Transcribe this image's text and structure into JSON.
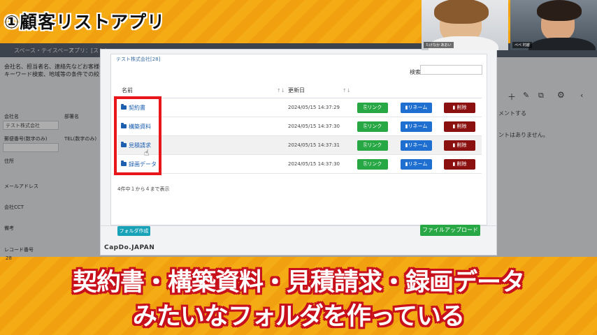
{
  "overlay": {
    "title": "①顧客リストアプリ",
    "caption_line1": "契約書・構築資料・見積請求・録画データ",
    "caption_line2": "みたいなフォルダを作っている"
  },
  "webcams": [
    {
      "label": "たけなか あおい"
    },
    {
      "label": "ぺぺ 村越"
    }
  ],
  "background_app": {
    "nav": [
      "スペース・テイスペース",
      "アプリ：[ストレ"
    ],
    "description_1": "会社名、担当者名、連絡先などお客様の情",
    "description_2": "キーワード検索、地域等の条件での絞り込",
    "fields": [
      {
        "label": "会社名",
        "value": "テスト株式会社"
      },
      {
        "label": "郵便番号(数字のみ)",
        "value": ""
      },
      {
        "label": "住所",
        "value": ""
      },
      {
        "label": "メールアドレス",
        "value": ""
      },
      {
        "label": "会社CCT",
        "value": ""
      },
      {
        "label": "備考",
        "value": ""
      },
      {
        "label": "レコード番号",
        "value": "28"
      }
    ],
    "field_department": "部署名",
    "field_tel": "TEL(数字のみ)",
    "right_comment": "メントする",
    "right_nocomment": "ントはありません。"
  },
  "modal": {
    "company": "テスト株式会社[28]",
    "search_label": "検索",
    "search_value": "",
    "col_name": "名前",
    "col_updated": "更新日",
    "rows": [
      {
        "name": "契約書",
        "updated": "2024/05/15 14:37:29",
        "link": "リンク",
        "rename": "リネーム",
        "delete": "削除"
      },
      {
        "name": "構築資料",
        "updated": "2024/05/15 14:37:30",
        "link": "リンク",
        "rename": "リネーム",
        "delete": "削除"
      },
      {
        "name": "見積請求",
        "updated": "2024/05/15 14:37:31",
        "link": "リンク",
        "rename": "リネーム",
        "delete": "削除"
      },
      {
        "name": "録画データ",
        "updated": "2024/05/15 14:37:30",
        "link": "リンク",
        "rename": "リネーム",
        "delete": "削除"
      }
    ],
    "count_text": "4件中１から４まで表示",
    "create_folder": "フォルダ作成",
    "upload": "ファイルアップロード",
    "logo": "CapDo.JAPAN"
  },
  "colors": {
    "background_orange": "#f3a512",
    "highlight_red": "#e8161a",
    "link_green": "#28a745",
    "rename_blue": "#1f6fd1",
    "delete_darkred": "#8b1010"
  }
}
